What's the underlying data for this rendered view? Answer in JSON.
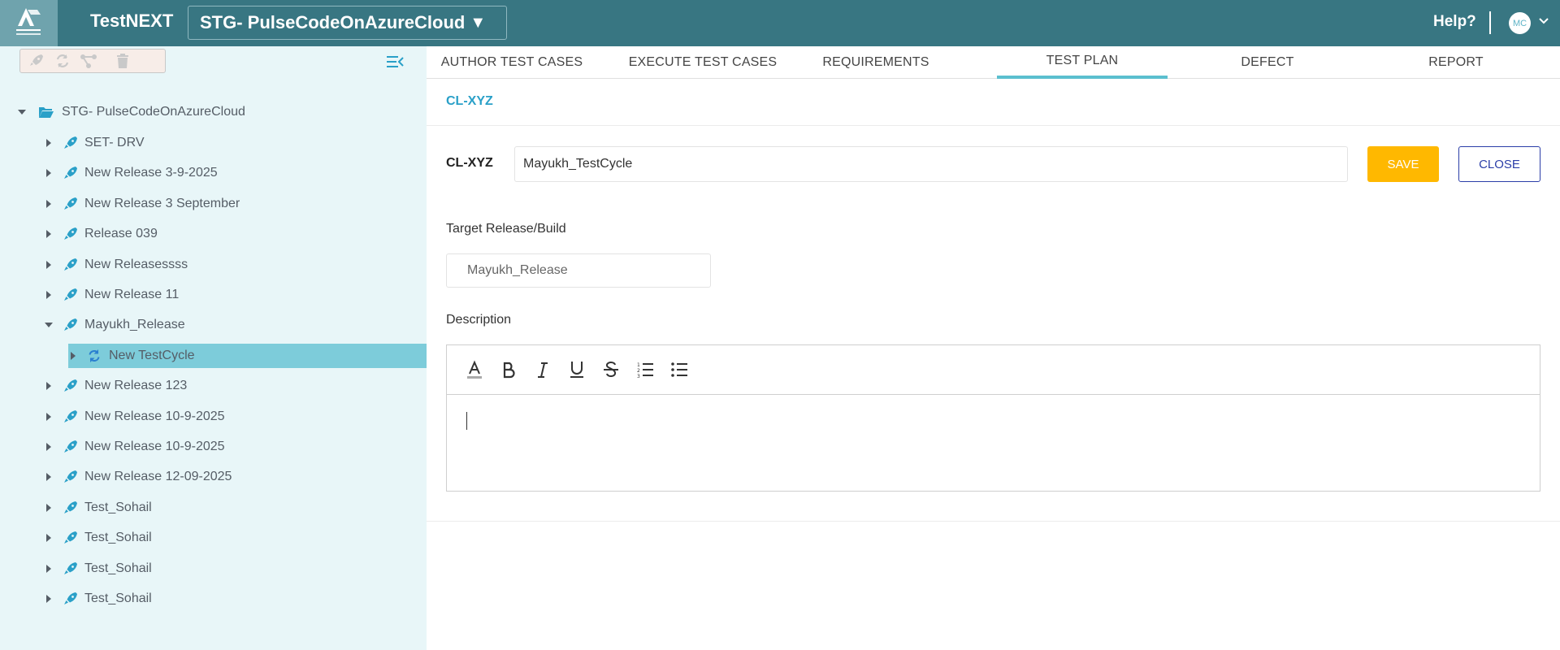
{
  "header": {
    "app_name": "TestNEXT",
    "project": "STG- PulseCodeOnAzureCloud",
    "project_caret": "▼",
    "help": "Help?",
    "user_initials": "MC"
  },
  "colors": {
    "header_bg": "#387682",
    "sidebar_bg": "#e8f6f8",
    "selected_row": "#7dccda",
    "accent": "#5bbfcf",
    "icon_blue": "#2aa0c8",
    "save_bg": "#ffb800",
    "close_border": "#2b3ea8"
  },
  "tree": {
    "root": "STG- PulseCodeOnAzureCloud",
    "items": [
      {
        "label": "SET- DRV",
        "icon": "rocket-icon"
      },
      {
        "label": "New Release 3-9-2025",
        "icon": "rocket-icon"
      },
      {
        "label": "New Release 3 September",
        "icon": "rocket-icon"
      },
      {
        "label": "Release 039",
        "icon": "rocket-icon"
      },
      {
        "label": "New Releasessss",
        "icon": "rocket-icon"
      },
      {
        "label": "New Release 11",
        "icon": "rocket-icon"
      },
      {
        "label": "Mayukh_Release",
        "icon": "rocket-icon",
        "expanded": true
      },
      {
        "label": "New TestCycle",
        "icon": "cycle-icon",
        "selected": true
      },
      {
        "label": "New Release 123",
        "icon": "rocket-icon"
      },
      {
        "label": "New Release 10-9-2025",
        "icon": "rocket-icon"
      },
      {
        "label": "New Release 10-9-2025",
        "icon": "rocket-icon"
      },
      {
        "label": "New Release 12-09-2025",
        "icon": "rocket-icon"
      },
      {
        "label": "Test_Sohail",
        "icon": "rocket-icon"
      },
      {
        "label": "Test_Sohail",
        "icon": "rocket-icon"
      },
      {
        "label": "Test_Sohail",
        "icon": "rocket-icon"
      },
      {
        "label": "Test_Sohail",
        "icon": "rocket-icon"
      }
    ]
  },
  "tabs": [
    {
      "label": "AUTHOR TEST CASES"
    },
    {
      "label": "EXECUTE TEST CASES"
    },
    {
      "label": "REQUIREMENTS"
    },
    {
      "label": "TEST PLAN",
      "active": true
    },
    {
      "label": "DEFECT"
    },
    {
      "label": "REPORT"
    }
  ],
  "main": {
    "breadcrumb": "CL-XYZ",
    "name_label": "CL-XYZ",
    "name_value": "Mayukh_TestCycle",
    "save": "SAVE",
    "close": "CLOSE",
    "target_label": "Target Release/Build",
    "target_value": "Mayukh_Release",
    "description_label": "Description",
    "editor_tools": [
      "font-color-icon",
      "bold-icon",
      "italic-icon",
      "underline-icon",
      "strikethrough-icon",
      "ordered-list-icon",
      "bullet-list-icon"
    ]
  }
}
